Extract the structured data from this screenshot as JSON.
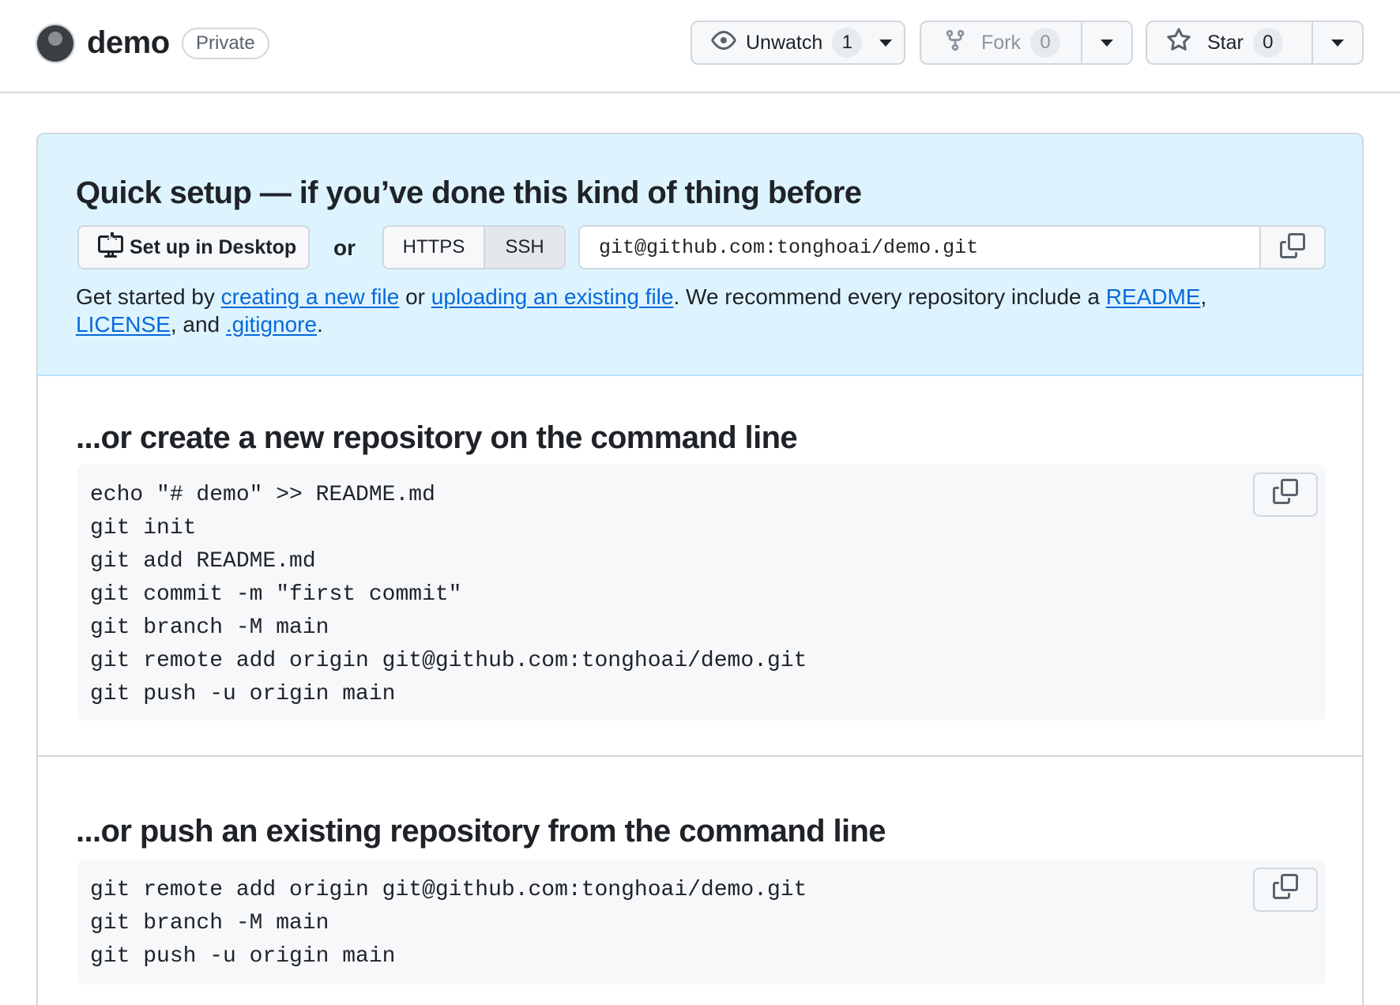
{
  "header": {
    "repo_name": "demo",
    "visibility": "Private",
    "unwatch": {
      "label": "Unwatch",
      "count": "1"
    },
    "fork": {
      "label": "Fork",
      "count": "0"
    },
    "star": {
      "label": "Star",
      "count": "0"
    }
  },
  "quick_setup": {
    "title": "Quick setup — if you’ve done this kind of thing before",
    "desktop_button": "Set up in Desktop",
    "or_text": "or",
    "protocols": [
      "HTTPS",
      "SSH"
    ],
    "selected_protocol": "SSH",
    "clone_url": "git@github.com:tonghoai/demo.git",
    "description": {
      "p1": "Get started by ",
      "link_new_file": "creating a new file",
      "p2": " or ",
      "link_upload": "uploading an existing file",
      "p3": ". We recommend every repository include a ",
      "link_readme": "README",
      "p4": ", ",
      "link_license": "LICENSE",
      "p5": ", and ",
      "link_gitignore": ".gitignore",
      "p6": "."
    }
  },
  "create_section": {
    "title": "...or create a new repository on the command line",
    "lines": [
      "echo \"# demo\" >> README.md",
      "git init",
      "git add README.md",
      "git commit -m \"first commit\"",
      "git branch -M main",
      "git remote add origin git@github.com:tonghoai/demo.git",
      "git push -u origin main"
    ]
  },
  "push_section": {
    "title": "...or push an existing repository from the command line",
    "lines": [
      "git remote add origin git@github.com:tonghoai/demo.git",
      "git branch -M main",
      "git push -u origin main"
    ]
  },
  "icons": {
    "eye": "eye-icon",
    "fork": "repo-forked-icon",
    "star": "star-icon",
    "desktop": "desktop-download-icon",
    "copy": "copy-icon"
  },
  "colors": {
    "link": "#0969da",
    "quick_setup_bg": "#ddf4ff",
    "border": "#d0d7de",
    "code_bg": "#f6f8fa"
  }
}
